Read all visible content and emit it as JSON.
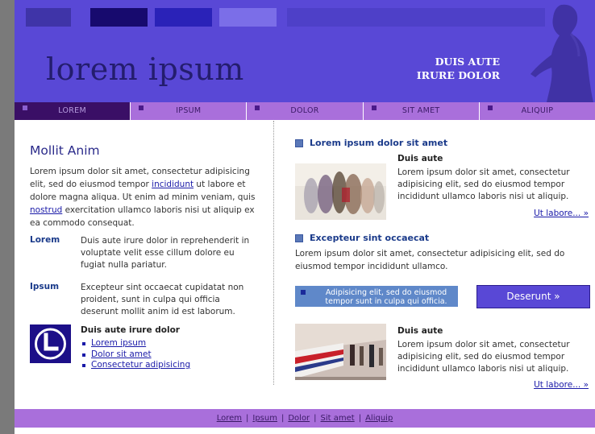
{
  "header": {
    "logo": "lorem ipsum",
    "tagline_line1": "DUIS AUTE",
    "tagline_line2": "IRURE DOLOR",
    "color_blocks": [
      "#3f34a8",
      "#170a6e",
      "#2a22b8",
      "#7b6ee8",
      "#4e40c8"
    ]
  },
  "nav": {
    "items": [
      "LOREM",
      "IPSUM",
      "DOLOR",
      "SIT AMET",
      "ALIQUIP"
    ],
    "active_index": 0
  },
  "left": {
    "title": "Mollit Anim",
    "intro_1": "Lorem ipsum dolor sit amet, consectetur adipisicing elit, sed do eiusmod tempor ",
    "intro_link_1": "incididunt",
    "intro_2": " ut labore et dolore magna aliqua. Ut enim ad minim veniam, quis ",
    "intro_link_2": "nostrud",
    "intro_3": " exercitation ullamco laboris nisi ut aliquip ex ea commodo consequat.",
    "terms": [
      {
        "term": "Lorem",
        "definition": "Duis aute irure dolor in reprehenderit in voluptate velit esse cillum dolore eu fugiat nulla pariatur."
      },
      {
        "term": "Ipsum",
        "definition": "Excepteur sint occaecat cupidatat non proident, sunt in culpa qui officia deserunt mollit anim id est laborum."
      }
    ],
    "box_title": "Duis aute irure dolor",
    "box_links": [
      "Lorem ipsum",
      "Dolor sit amet",
      "Consectetur adipisicing"
    ]
  },
  "right": {
    "section1_title": "Lorem ipsum dolor sit amet",
    "article1_title": "Duis aute",
    "article1_text": "Lorem ipsum dolor sit amet, consectetur adipisicing elit, sed do eiusmod tempor incididunt ullamco laboris nisi ut aliquip.",
    "article1_more": "Ut labore... »",
    "section2_title": "Excepteur sint occaecat",
    "section2_text": "Lorem ipsum dolor sit amet, consectetur adipisicing elit, sed do eiusmod tempor incididunt ullamco.",
    "callout_text": "Adipisicing elit, sed do eiusmod tempor sunt in culpa qui officia.",
    "button_label": "Deserunt »",
    "article2_title": "Duis aute",
    "article2_text": "Lorem ipsum dolor sit amet, consectetur adipisicing elit, sed do eiusmod tempor incididunt ullamco laboris nisi ut aliquip.",
    "article2_more": "Ut labore... »"
  },
  "footer": {
    "links": [
      "Lorem",
      "Ipsum",
      "Dolor",
      "Sit amet",
      "Aliquip"
    ],
    "separator": "|"
  }
}
